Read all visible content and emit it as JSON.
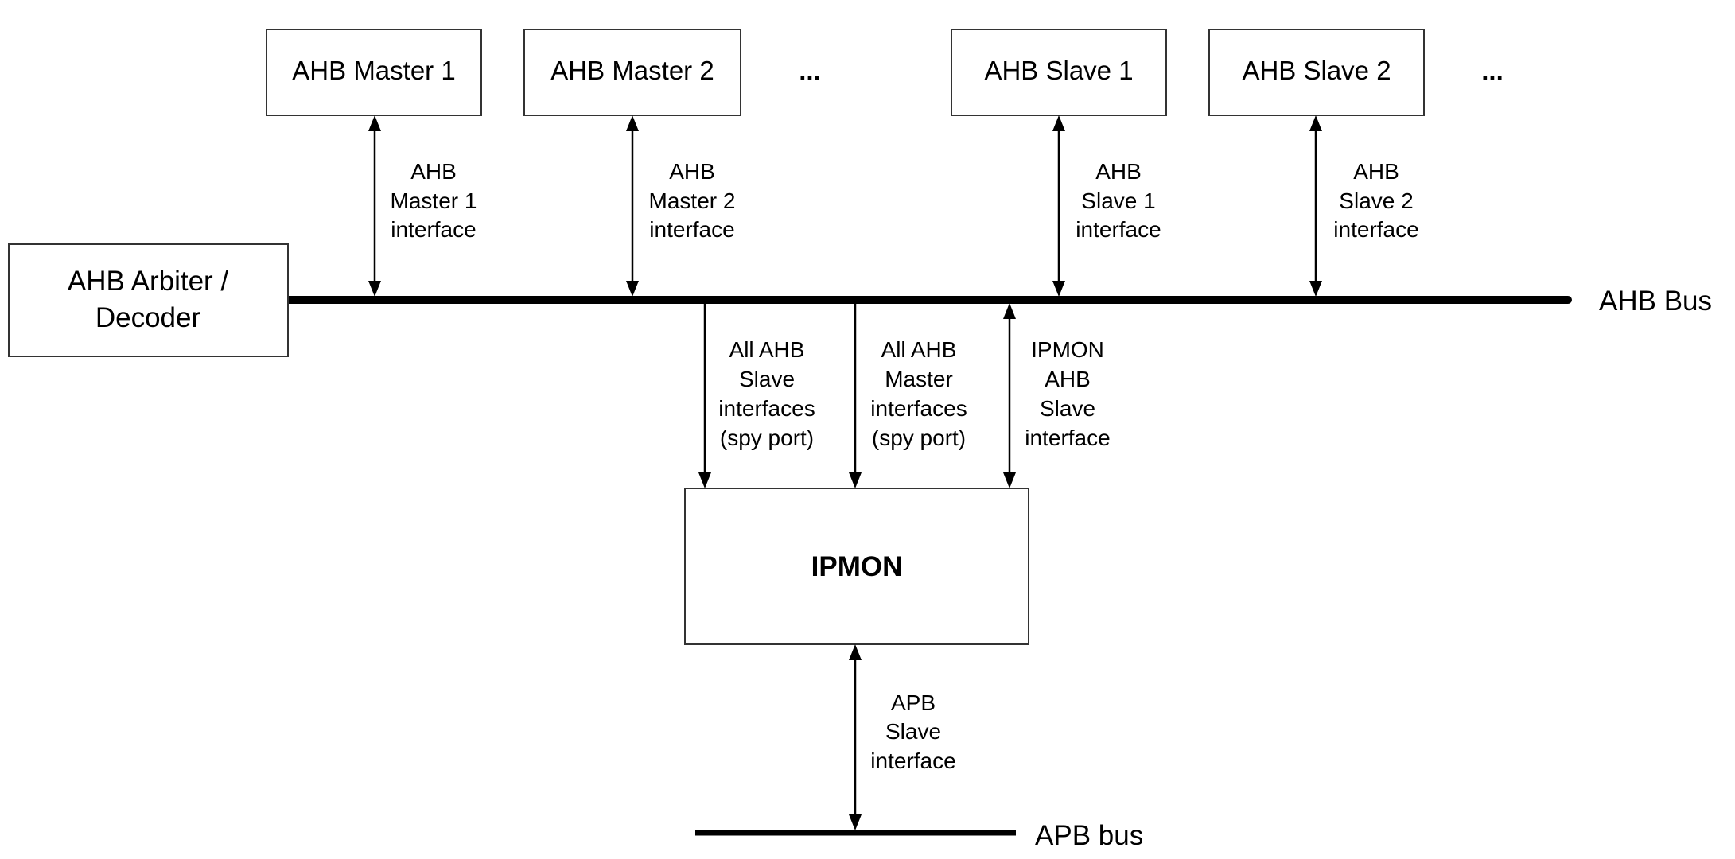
{
  "diagram": {
    "masters": [
      {
        "label": "AHB Master 1",
        "interface": [
          "AHB",
          "Master 1",
          "interface"
        ]
      },
      {
        "label": "AHB Master 2",
        "interface": [
          "AHB",
          "Master 2",
          "interface"
        ]
      }
    ],
    "masters_ellipsis": "...",
    "slaves": [
      {
        "label": "AHB Slave 1",
        "interface": [
          "AHB",
          "Slave 1",
          "interface"
        ]
      },
      {
        "label": "AHB Slave 2",
        "interface": [
          "AHB",
          "Slave 2",
          "interface"
        ]
      }
    ],
    "slaves_ellipsis": "...",
    "arbiter": {
      "lines": [
        "AHB Arbiter /",
        "Decoder"
      ]
    },
    "ahb_bus_label": "AHB Bus",
    "ipmon": {
      "label": "IPMON"
    },
    "spy_links": [
      {
        "lines": [
          "All AHB",
          "Slave",
          "interfaces",
          "(spy port)"
        ],
        "direction": "bus-to-ipmon"
      },
      {
        "lines": [
          "All AHB",
          "Master",
          "interfaces",
          "(spy port)"
        ],
        "direction": "bus-to-ipmon"
      },
      {
        "lines": [
          "IPMON",
          "AHB",
          "Slave",
          "interface"
        ],
        "direction": "bidirectional"
      }
    ],
    "apb_link": {
      "lines": [
        "APB",
        "Slave",
        "interface"
      ],
      "direction": "bidirectional"
    },
    "apb_bus_label": "APB bus"
  }
}
